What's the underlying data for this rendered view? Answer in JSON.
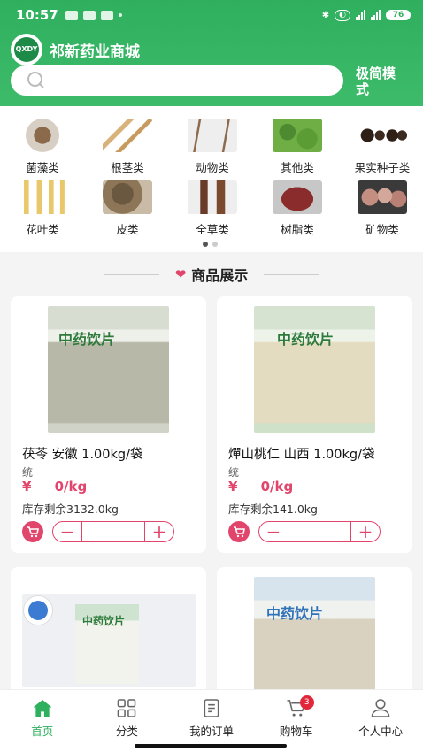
{
  "status_bar": {
    "time": "10:57",
    "battery": "76"
  },
  "header": {
    "title": "祁新药业商城",
    "logo_text": "QXDY",
    "mode_label": "极简模式"
  },
  "search": {
    "placeholder": "",
    "value": ""
  },
  "categories": [
    {
      "label": "菌藻类",
      "icon": "fungus-image"
    },
    {
      "label": "根茎类",
      "icon": "root-image"
    },
    {
      "label": "动物类",
      "icon": "antler-image"
    },
    {
      "label": "其他类",
      "icon": "herb-image"
    },
    {
      "label": "果实种子类",
      "icon": "fruit-image"
    },
    {
      "label": "花叶类",
      "icon": "flower-image"
    },
    {
      "label": "皮类",
      "icon": "bark-image"
    },
    {
      "label": "全草类",
      "icon": "whole-herb-image"
    },
    {
      "label": "树脂类",
      "icon": "resin-image"
    },
    {
      "label": "矿物类",
      "icon": "mineral-image"
    }
  ],
  "pager": {
    "pages": 2,
    "current": 1
  },
  "section": {
    "title": "商品展示"
  },
  "products": [
    {
      "name": "茯苓 安徽 1.00kg/袋",
      "unit": "统",
      "currency": "¥",
      "price": "0/kg",
      "stock": "库存剩余3132.0kg",
      "package_text": "中药饮片"
    },
    {
      "name": "燀山桃仁 山西 1.00kg/袋",
      "unit": "统",
      "currency": "¥",
      "price": "0/kg",
      "stock": "库存剩余141.0kg",
      "package_text": "中药饮片"
    },
    {
      "name": "",
      "package_text": "中药饮片"
    },
    {
      "name": "",
      "package_text": "中药饮片"
    }
  ],
  "nav": [
    {
      "label": "首页",
      "icon": "home-icon",
      "active": true
    },
    {
      "label": "分类",
      "icon": "grid-icon",
      "active": false
    },
    {
      "label": "我的订单",
      "icon": "order-icon",
      "active": false
    },
    {
      "label": "购物车",
      "icon": "cart-icon",
      "active": false,
      "badge": "3"
    },
    {
      "label": "个人中心",
      "icon": "user-icon",
      "active": false
    }
  ],
  "colors": {
    "brand_green": "#2fb05e",
    "accent_pink": "#e2456b"
  }
}
